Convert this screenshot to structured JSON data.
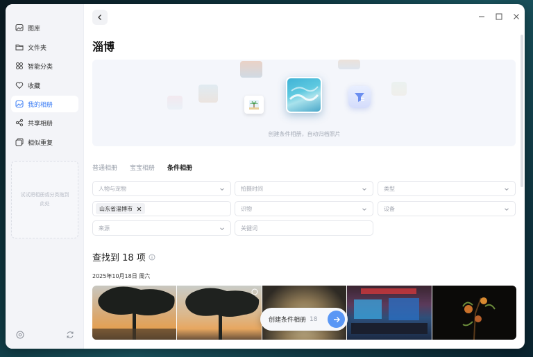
{
  "sidebar": {
    "items": [
      {
        "label": "图库",
        "icon": "image-icon"
      },
      {
        "label": "文件夹",
        "icon": "folder-icon"
      },
      {
        "label": "智能分类",
        "icon": "grid-icon"
      },
      {
        "label": "收藏",
        "icon": "heart-icon"
      },
      {
        "label": "我的相册",
        "icon": "album-icon",
        "active": true
      },
      {
        "label": "共享相册",
        "icon": "share-icon"
      },
      {
        "label": "相似重复",
        "icon": "duplicate-icon"
      }
    ],
    "drop_hint": "试试把相册或分类拖到此处"
  },
  "page": {
    "title": "淄博",
    "hero_caption": "创建条件相册，自动归档照片"
  },
  "tabs": [
    {
      "label": "普通相册",
      "active": false
    },
    {
      "label": "宝宝相册",
      "active": false
    },
    {
      "label": "条件相册",
      "active": true
    }
  ],
  "filters": {
    "people_pets": "人物与宠物",
    "shoot_time": "拍摄时间",
    "type": "类型",
    "location_chip": "山东省淄博市",
    "recognition": "识物",
    "device": "设备",
    "source": "来源",
    "keyword_placeholder": "关键词"
  },
  "results": {
    "title": "查找到 18 项",
    "date": "2025年10月18日 周六"
  },
  "fab": {
    "label": "创建条件相册",
    "count": "18"
  },
  "colors": {
    "accent": "#3a7cf5",
    "fab_button": "#5a97f5"
  }
}
